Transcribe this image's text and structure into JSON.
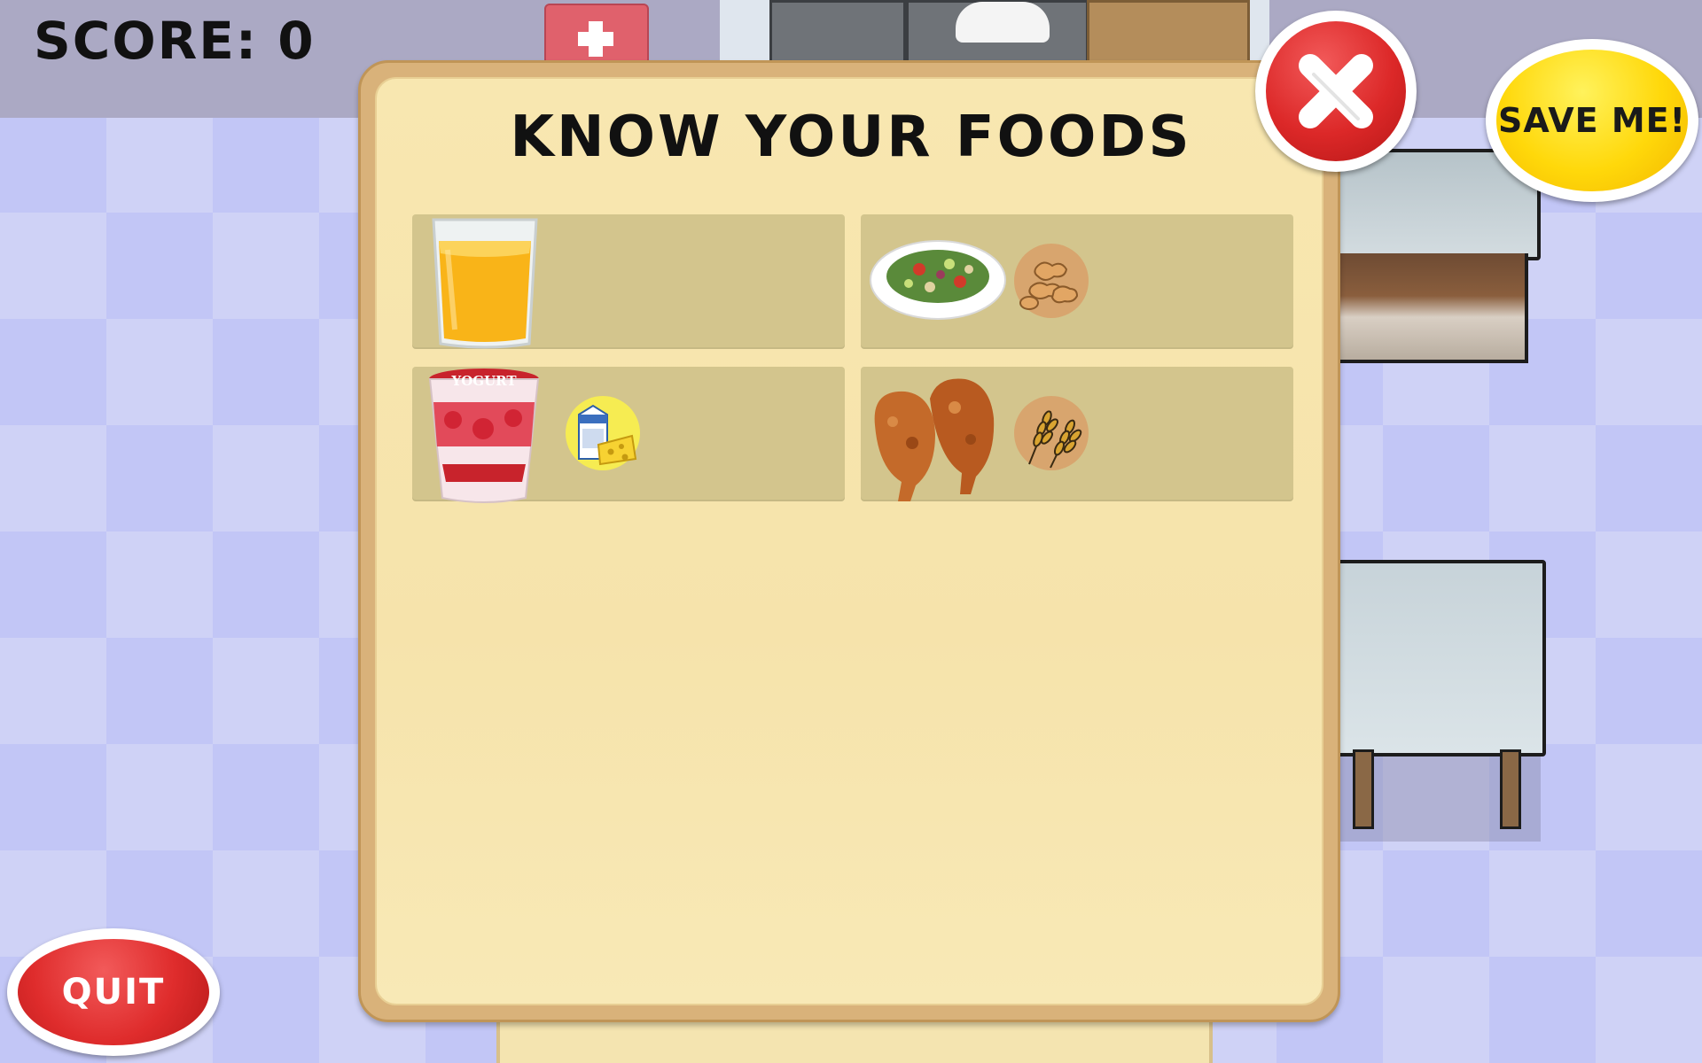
{
  "hud": {
    "score_label": "SCORE: 0"
  },
  "panel": {
    "title": "KNOW YOUR FOODS"
  },
  "foods": [
    {
      "item": "orange-juice-glass",
      "allergen_icon": null
    },
    {
      "item": "salad-plate",
      "allergen_icon": "peanut-icon"
    },
    {
      "item": "strawberry-yogurt-cup",
      "allergen_icon": "milk-cheese-icon",
      "label": "YOGURT"
    },
    {
      "item": "fried-chicken",
      "allergen_icon": "wheat-icon"
    }
  ],
  "buttons": {
    "close_icon": "close-x-icon",
    "save_me": "SAVE ME!",
    "quit": "QUIT"
  },
  "colors": {
    "close_red": "#dc2828",
    "save_yellow": "#ffd80a",
    "quit_red": "#df2c2c",
    "panel_fill": "#f6e3ab",
    "card_fill": "#d3c58d",
    "badge_yellow": "#f6ec52",
    "badge_tan": "#d8a56e"
  }
}
